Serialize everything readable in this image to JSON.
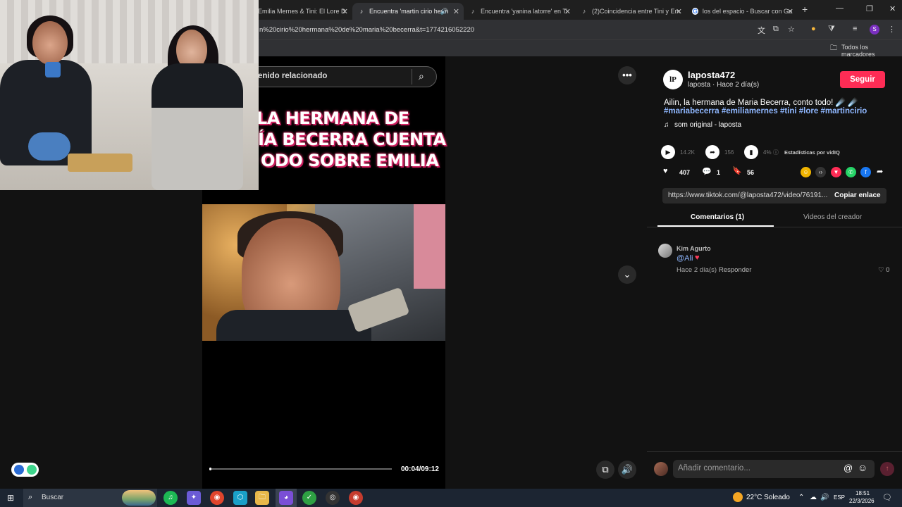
{
  "browser": {
    "tabs": [
      {
        "label": "Emilia Mernes & Tini: El Lore D",
        "icon": "page-icon",
        "active": false
      },
      {
        "label": "Encuentra 'martin cirio herm",
        "icon": "tiktok-icon",
        "active": true,
        "audio": "🔊"
      },
      {
        "label": "Encuentra 'yanina latorre' en Ti",
        "icon": "tiktok-icon",
        "active": false
      },
      {
        "label": "(2)Coincidencia entre Tini y Em",
        "icon": "tiktok-icon",
        "active": false
      },
      {
        "label": "los del espacio - Buscar con Go",
        "icon": "google-icon",
        "active": false
      }
    ],
    "close_glyph": "✕",
    "new_tab": "+",
    "url": "n%20cirio%20hermana%20de%20maria%20becerra&t=1774216052220",
    "bookmarks_all": "Todos los marcadores",
    "profile_letter": "S"
  },
  "video": {
    "search_text": "enido relacionado",
    "overlay_lines": [
      "LA HERMANA DE",
      "ÍA BECERRA CUENTA",
      "ODO SOBRE EMILIA"
    ],
    "time": "00:04/09:12",
    "progress_fraction": 0.007
  },
  "post": {
    "avatar_initials": "lP",
    "username": "laposta472",
    "subline": "laposta · Hace 2 día(s)",
    "follow_label": "Seguir",
    "caption": "Ailin, la hermana de Maria Becerra, conto todo! ☄️ ☄️",
    "hashtags": "#mariabecerra #emiliamernes #tini #lore #martincirio",
    "sound": "som original - laposta",
    "stats": {
      "plays": "14.2K",
      "shares_stat": "156",
      "percent": "4%",
      "vidiq_label": "Estadísticas por vidIQ"
    },
    "likes": "407",
    "comments_count": "1",
    "saves": "56",
    "link_url": "https://www.tiktok.com/@laposta472/video/76191...",
    "copy_label": "Copiar enlace",
    "tab_comments": "Comentarios (1)",
    "tab_creator": "Videos del creador"
  },
  "comment": {
    "author": "Kim Agurto",
    "text": "@Ali",
    "date": "Hace 2 día(s)",
    "reply_label": "Responder",
    "likes": "0"
  },
  "composer": {
    "placeholder": "Añadir comentario...",
    "at_glyph": "@"
  },
  "taskbar": {
    "search_label": "Buscar",
    "weather": "22°C  Soleado",
    "lang": "ESP",
    "time": "18:51",
    "date": "22/3/2026"
  },
  "colors": {
    "follow": "#fe2c55",
    "hashtag": "#8fb7ff",
    "overlay_glow": "#e0306a"
  }
}
